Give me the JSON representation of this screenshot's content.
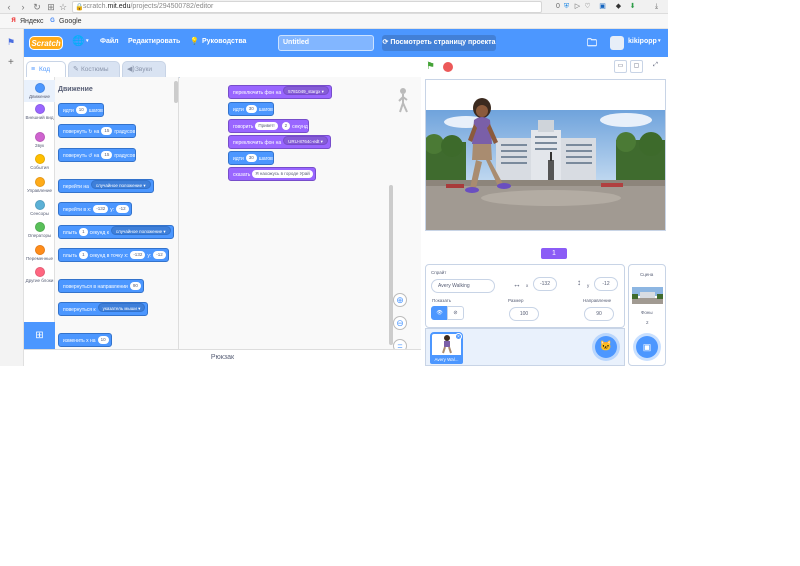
{
  "browser": {
    "url_prefix": "scratch.",
    "url_domain": "mit.edu",
    "url_path": "/projects/294500782/editor",
    "bookmarks": [
      "Яндекс",
      "Google"
    ],
    "ext_count": "0"
  },
  "menubar": {
    "logo": "Scratch",
    "file": "Файл",
    "edit": "Редактировать",
    "tutorials": "Руководства",
    "title": "Untitled",
    "see_project": "Посмотреть страницу проекта",
    "username": "kikipopp"
  },
  "tabs": {
    "code": "Код",
    "costumes": "Костюмы",
    "sounds": "Звуки"
  },
  "categories": [
    {
      "label": "Движение",
      "color": "#4c97ff"
    },
    {
      "label": "Внешний вид",
      "color": "#9966ff"
    },
    {
      "label": "Звук",
      "color": "#cf63cf"
    },
    {
      "label": "События",
      "color": "#ffbf00"
    },
    {
      "label": "Управление",
      "color": "#ffab19"
    },
    {
      "label": "Сенсоры",
      "color": "#5cb1d6"
    },
    {
      "label": "Операторы",
      "color": "#59c059"
    },
    {
      "label": "Переменные",
      "color": "#ff8c1a"
    },
    {
      "label": "Другие блоки",
      "color": "#ff6680"
    }
  ],
  "palette": {
    "title": "Движение",
    "move": {
      "pre": "идти",
      "val": "10",
      "post": "шагов"
    },
    "turn_right": {
      "pre": "повернуть",
      "mid": "на",
      "val": "15",
      "post": "градусов"
    },
    "turn_left": {
      "pre": "повернуть",
      "mid": "на",
      "val": "15",
      "post": "градусов"
    },
    "goto": {
      "pre": "перейти на",
      "dd": "случайное положение"
    },
    "goto_xy": {
      "pre": "перейти в x:",
      "x": "-132",
      "ymid": "y:",
      "y": "-12"
    },
    "glide": {
      "pre": "плыть",
      "val": "1",
      "mid": "секунд к",
      "dd": "случайное положение"
    },
    "glide_xy": {
      "pre": "плыть",
      "val": "1",
      "mid": "секунд в точку x:",
      "x": "-132",
      "ymid": "y:",
      "y": "-12"
    },
    "point": {
      "pre": "повернуться в направлении",
      "val": "90"
    },
    "point_towards": {
      "pre": "повернуться к",
      "dd": "указатель мыши"
    },
    "change_x": {
      "pre": "изменить х на",
      "val": "10"
    }
  },
  "script": {
    "b1": {
      "pre": "переключить фон на",
      "dd": "5781049_stargx"
    },
    "b2": {
      "pre": "идти",
      "val": "30",
      "post": "шагов"
    },
    "b3": {
      "pre": "говорить",
      "val": "Привет!",
      "val2": "2",
      "post": "секунд"
    },
    "b4": {
      "pre": "переключить фон на",
      "dd": "URU-8764c-edt"
    },
    "b5": {
      "pre": "идти",
      "val": "30",
      "post": "шагов"
    },
    "b6": {
      "pre": "сказать",
      "val": "Я нахожусь в городе Урай"
    }
  },
  "backpack": "Рюкзак",
  "stage": {
    "page": "1"
  },
  "sprite_info": {
    "sprite_label": "Спрайт",
    "sprite_name": "Avery Walking",
    "x_label": "x",
    "x": "-132",
    "y_label": "y",
    "y": "-12",
    "show_label": "Показать",
    "size_label": "Размер",
    "size": "100",
    "direction_label": "Направление",
    "direction": "90"
  },
  "sprite_list": {
    "thumb_label": "Avery Wal..."
  },
  "stage_target": {
    "label": "Сцена",
    "backdrops_label": "Фоны",
    "backdrops_count": "2"
  }
}
